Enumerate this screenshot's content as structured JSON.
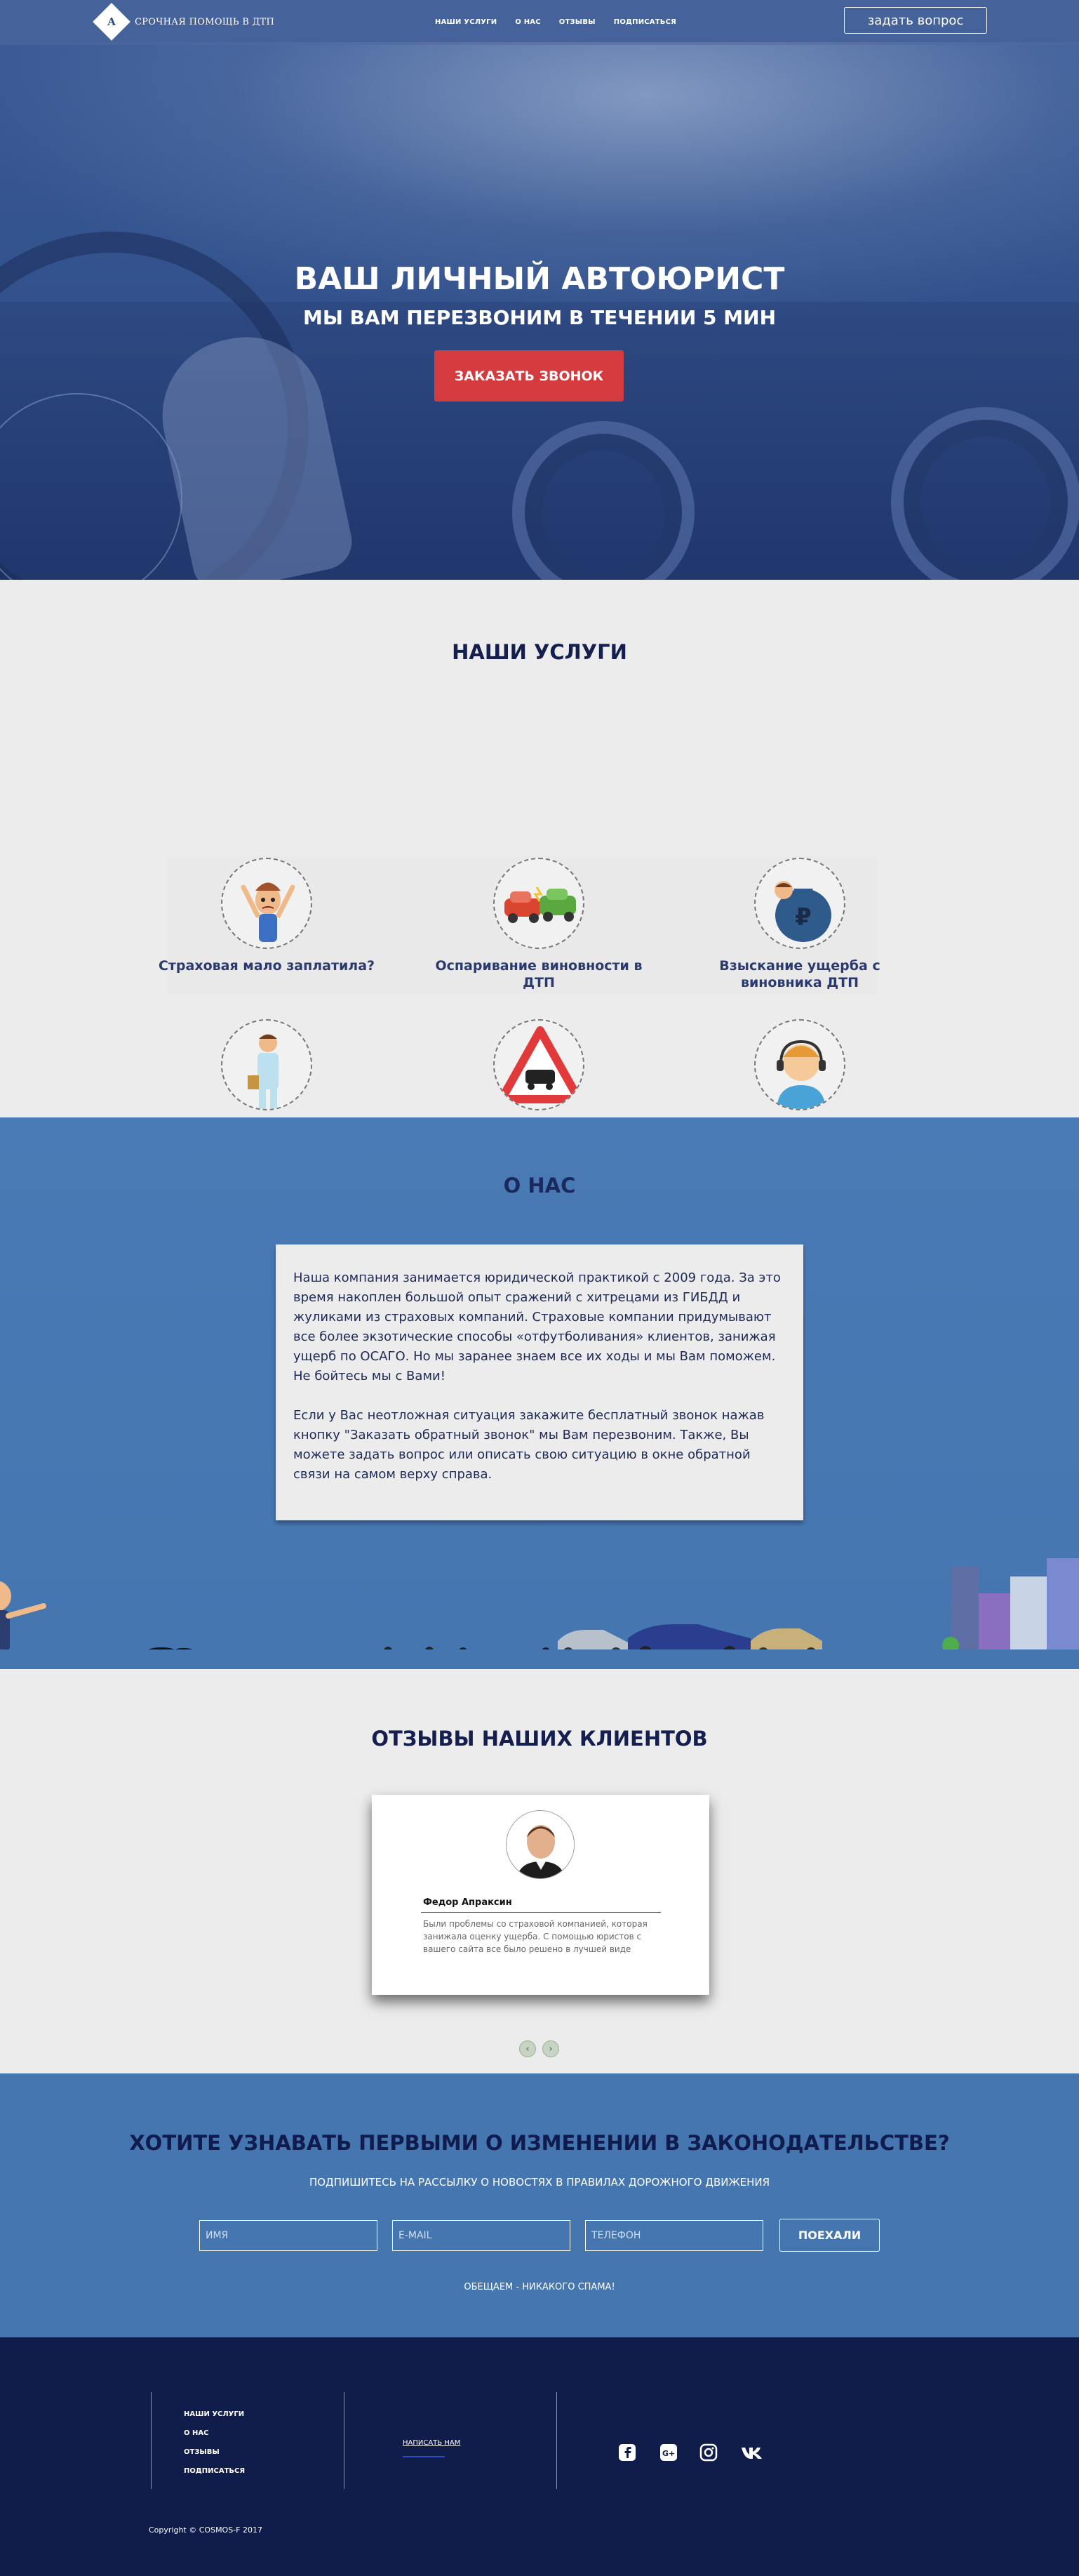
{
  "header": {
    "logo_text": "СРОЧНАЯ ПОМОЩЬ В ДТП",
    "logo_mark": "А",
    "nav": [
      "НАШИ УСЛУГИ",
      "О НАС",
      "ОТЗЫВЫ",
      "ПОДПИСАТЬСЯ"
    ],
    "ask_button": "задать вопрос"
  },
  "hero": {
    "title": "ВАШ ЛИЧНЫЙ АВТОЮРИСТ",
    "subtitle": "МЫ ВАМ ПЕРЕЗВОНИМ В ТЕЧЕНИИ 5 МИН",
    "button": "ЗАКАЗАТЬ ЗВОНОК"
  },
  "services": {
    "title": "НАШИ УСЛУГИ",
    "items": [
      {
        "label": "Страховая мало заплатила?",
        "icon": "angry-man-icon"
      },
      {
        "label": "Оспаривание виновности в ДТП",
        "icon": "car-crash-icon"
      },
      {
        "label": "Взыскание ущерба с виновника ДТП",
        "icon": "money-bag-icon"
      },
      {
        "label": "",
        "icon": "businessman-icon"
      },
      {
        "label": "",
        "icon": "warning-sign-icon"
      },
      {
        "label": "",
        "icon": "support-operator-icon"
      }
    ]
  },
  "about": {
    "title": "О НАС",
    "paragraphs": [
      "Наша компания занимается юридической практикой с 2009 года. За это время накоплен большой опыт сражений с хитрецами из ГИБДД и жуликами из страховых компаний. Страховые компании придумывают все более экзотические способы «отфутболивания» клиентов, занижая ущерб по ОСАГО. Но мы заранее знаем все их ходы и мы Вам поможем. Не бойтесь мы с Вами!",
      "Если у Вас неотложная ситуация закажите бесплатный звонок нажав кнопку \"Заказать обратный звонок\" мы Вам перезвоним. Также, Вы можете задать вопрос или описать свою ситуацию в окне обратной связи на самом верху справа."
    ]
  },
  "reviews": {
    "title": "ОТЗЫВЫ НАШИХ КЛИЕНТОВ",
    "items": [
      {
        "name": "Федор Апраксин",
        "text": "Были проблемы со страховой компанией, которая занижала оценку ущерба. С помощью юристов с вашего сайта все было решено в лучшей виде"
      }
    ],
    "prev": "‹",
    "next": "›"
  },
  "subscribe": {
    "title": "ХОТИТЕ УЗНАВАТЬ ПЕРВЫМИ О ИЗМЕНЕНИИ В ЗАКОНОДАТЕЛЬСТВЕ?",
    "caption": "ПОДПИШИТЕСЬ НА РАССЫЛКУ О НОВОСТЯХ В ПРАВИЛАХ ДОРОЖНОГО ДВИЖЕНИЯ",
    "name_placeholder": "ИМЯ",
    "email_placeholder": "E-MAIL",
    "phone_placeholder": "ТЕЛЕФОН",
    "button": "ПОЕХАЛИ",
    "note": "ОБЕЩАЕМ - НИКАКОГО СПАМА!"
  },
  "footer": {
    "nav": [
      "НАШИ УСЛУГИ",
      "О НАС",
      "ОТЗЫВЫ",
      "ПОДПИСАТЬСЯ"
    ],
    "write_link": "НАПИСАТЬ НАМ",
    "social": [
      {
        "name": "facebook-icon",
        "glyph": "f"
      },
      {
        "name": "google-plus-icon",
        "glyph": "G+"
      },
      {
        "name": "instagram-icon",
        "glyph": "◎"
      },
      {
        "name": "vk-icon",
        "glyph": "vk"
      }
    ],
    "copyright": "Copyright © COSMOS-F 2017"
  },
  "colors": {
    "navy": "#101d4b",
    "blue": "#4676b0",
    "red_button": "#d33b3f",
    "light_bg": "#ececec"
  }
}
